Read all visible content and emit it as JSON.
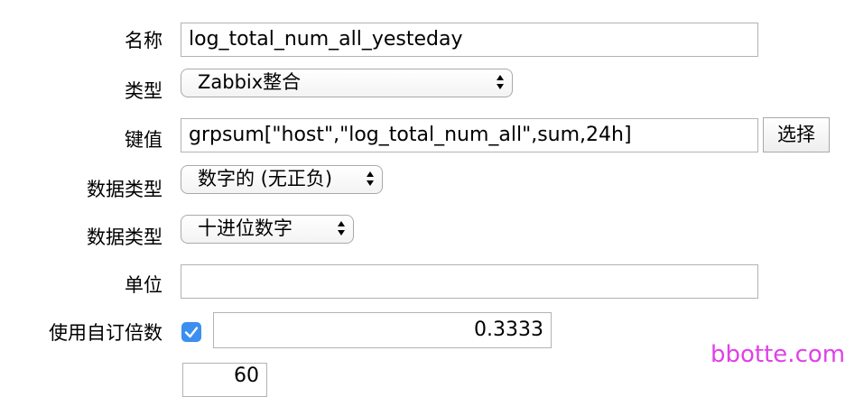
{
  "form": {
    "name": {
      "label": "名称",
      "value": "log_total_num_all_yesteday"
    },
    "type": {
      "label": "类型",
      "selected": "Zabbix整合"
    },
    "key": {
      "label": "键值",
      "value": "grpsum[\"host\",\"log_total_num_all\",sum,24h]",
      "select_button": "选择"
    },
    "value_type": {
      "label": "数据类型",
      "selected": "数字的 (无正负)"
    },
    "data_format": {
      "label": "数据类型",
      "selected": "十进位数字"
    },
    "units": {
      "label": "单位",
      "value": ""
    },
    "multiplier": {
      "label": "使用自订倍数",
      "checked": true,
      "value": "0.3333"
    },
    "update_interval": {
      "value": "60"
    }
  },
  "watermark": "bbotte.com",
  "colors": {
    "checkbox": "#3b8ff0",
    "watermark": "#e040e8"
  }
}
